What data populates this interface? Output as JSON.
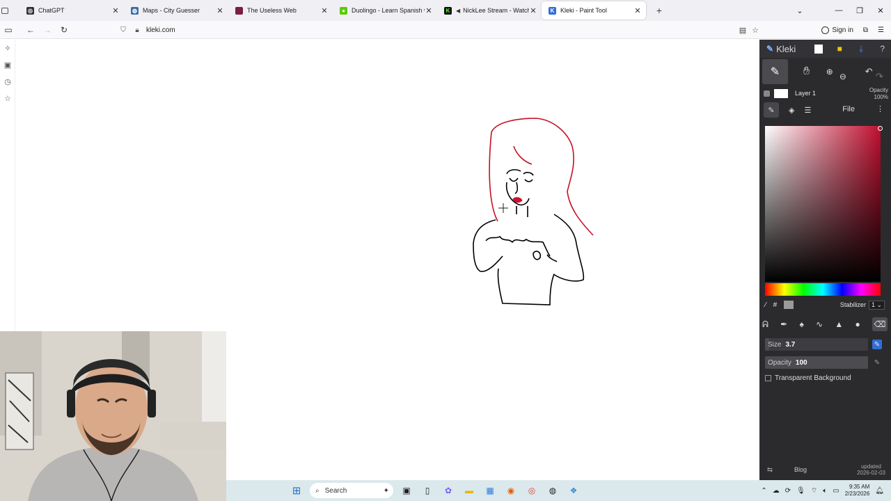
{
  "browser": {
    "tabs": [
      {
        "title": "ChatGPT",
        "favicon": "chatgpt-icon",
        "color": "#333333",
        "active": false
      },
      {
        "title": "Maps - City Guesser",
        "favicon": "globe-icon",
        "color": "#3a6ea5",
        "active": false
      },
      {
        "title": "The Useless Web",
        "favicon": "useless-web-icon",
        "color": "#7a1f3d",
        "active": false
      },
      {
        "title": "Duolingo - Learn Spanish with I",
        "favicon": "duolingo-icon",
        "color": "#58cc02",
        "active": false
      },
      {
        "title": "NickLee Stream - Watch Li",
        "favicon": "kick-icon",
        "color": "#53fc18",
        "active": false
      },
      {
        "title": "Kleki - Paint Tool",
        "favicon": "kleki-icon",
        "color": "#2f6fd6",
        "active": true
      }
    ],
    "url": "kleki.com",
    "sign_in": "Sign in"
  },
  "kleki": {
    "logo": "Kleki",
    "layer_name": "Layer 1",
    "layer_opacity_label": "Opacity",
    "layer_opacity_value": "100%",
    "tab_file": "File",
    "stabilizer_label": "Stabilizer",
    "stabilizer_value": "1",
    "hash": "#",
    "size_label": "Size",
    "size_value": "3.7",
    "opacity_label": "Opacity",
    "opacity_value": "100",
    "transparent_bg": "Transparent Background",
    "footer_blog": "Blog",
    "footer_updated": "updated",
    "footer_date": "2026-02-03",
    "current_color": "#c00f2f"
  },
  "taskbar": {
    "search_placeholder": "Search",
    "time": "9:35 AM",
    "date": "2/23/2026"
  }
}
